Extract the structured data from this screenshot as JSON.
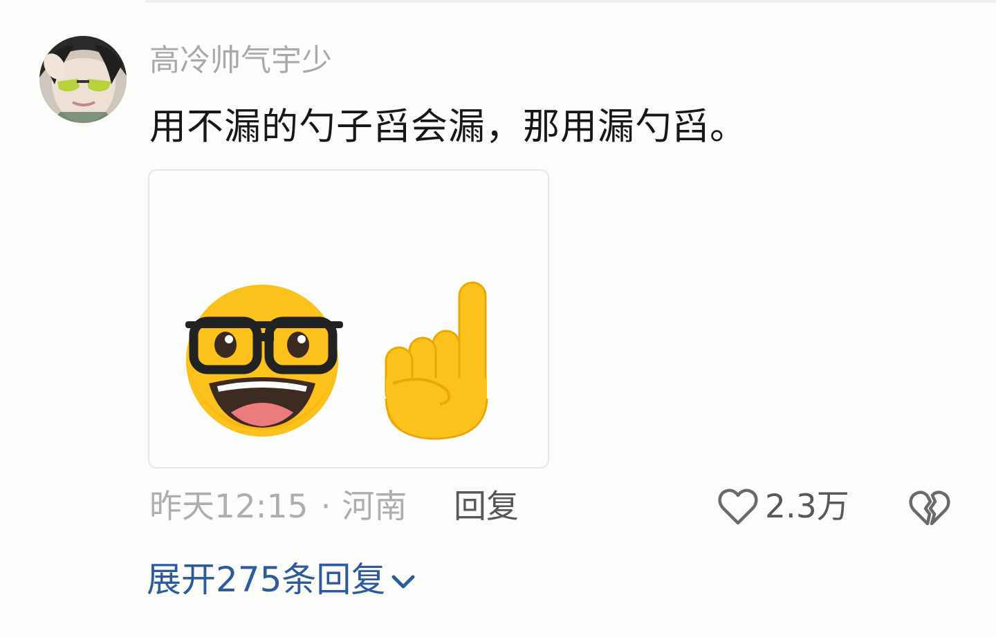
{
  "comment": {
    "username": "高冷帅气宇少",
    "text": "用不漏的勺子舀会漏，那用漏勺舀。",
    "image": {
      "emojis": [
        "nerd-face",
        "index-pointing-up"
      ]
    },
    "meta": {
      "time": "昨天12:15",
      "separator": "·",
      "location": "河南"
    },
    "reply_label": "回复",
    "likes": "2.3万",
    "expand_replies_label": "展开275条回复"
  },
  "icons": {
    "like": "heart-outline-icon",
    "dislike": "broken-heart-icon",
    "expand": "chevron-down-icon"
  },
  "colors": {
    "background": "#fcfcfa",
    "username": "#a9a9a9",
    "text": "#171717",
    "meta": "#aeaeae",
    "action": "#585858",
    "link": "#2d5c9d",
    "emoji_yellow": "#fcc21b"
  }
}
